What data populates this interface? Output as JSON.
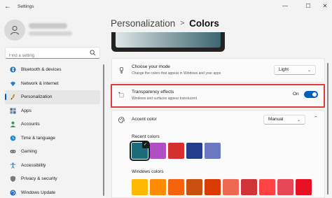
{
  "window": {
    "title": "Settings",
    "controls": {
      "minimize": "—",
      "maximize": "☐",
      "close": "✕"
    }
  },
  "sidebar": {
    "search_placeholder": "Find a setting",
    "items": [
      {
        "label": "Bluetooth & devices",
        "icon": "bluetooth-icon",
        "color": "#1b6ec2"
      },
      {
        "label": "Network & internet",
        "icon": "wifi-icon",
        "color": "#2a7bd6"
      },
      {
        "label": "Personalization",
        "icon": "brush-icon",
        "color": "#d08a3c",
        "active": true
      },
      {
        "label": "Apps",
        "icon": "apps-icon",
        "color": "#4b6ea8"
      },
      {
        "label": "Accounts",
        "icon": "person-icon",
        "color": "#2b9a5a"
      },
      {
        "label": "Time & language",
        "icon": "globe-clock-icon",
        "color": "#1b8fd4"
      },
      {
        "label": "Gaming",
        "icon": "gamepad-icon",
        "color": "#6b6b6b"
      },
      {
        "label": "Accessibility",
        "icon": "accessibility-icon",
        "color": "#2a73c8"
      },
      {
        "label": "Privacy & security",
        "icon": "shield-icon",
        "color": "#7a7a7a"
      },
      {
        "label": "Windows Update",
        "icon": "update-icon",
        "color": "#1b6ec2"
      }
    ]
  },
  "breadcrumb": {
    "parent": "Personalization",
    "separator": ">",
    "current": "Colors"
  },
  "mode": {
    "title": "Choose your mode",
    "subtitle": "Change the colors that appear in Windows and your apps",
    "value": "Light"
  },
  "transparency": {
    "title": "Transparency effects",
    "subtitle": "Windows and surfaces appear translucent",
    "state_label": "On",
    "enabled": true
  },
  "accent": {
    "title": "Accent color",
    "value": "Manual",
    "recent_label": "Recent colors",
    "recent_colors": [
      "#1d6b78",
      "#b04fc4",
      "#d62f2f",
      "#233f8c",
      "#6a79c2"
    ],
    "windows_label": "Windows colors",
    "windows_colors": [
      "#ffb900",
      "#ff8c00",
      "#f7630c",
      "#ca5010",
      "#da3b01",
      "#ef6950",
      "#d13438",
      "#ff4343",
      "#e74856",
      "#e81123"
    ]
  },
  "colors": {
    "accent": "#005fb8",
    "highlight_border": "#e23a3a"
  }
}
